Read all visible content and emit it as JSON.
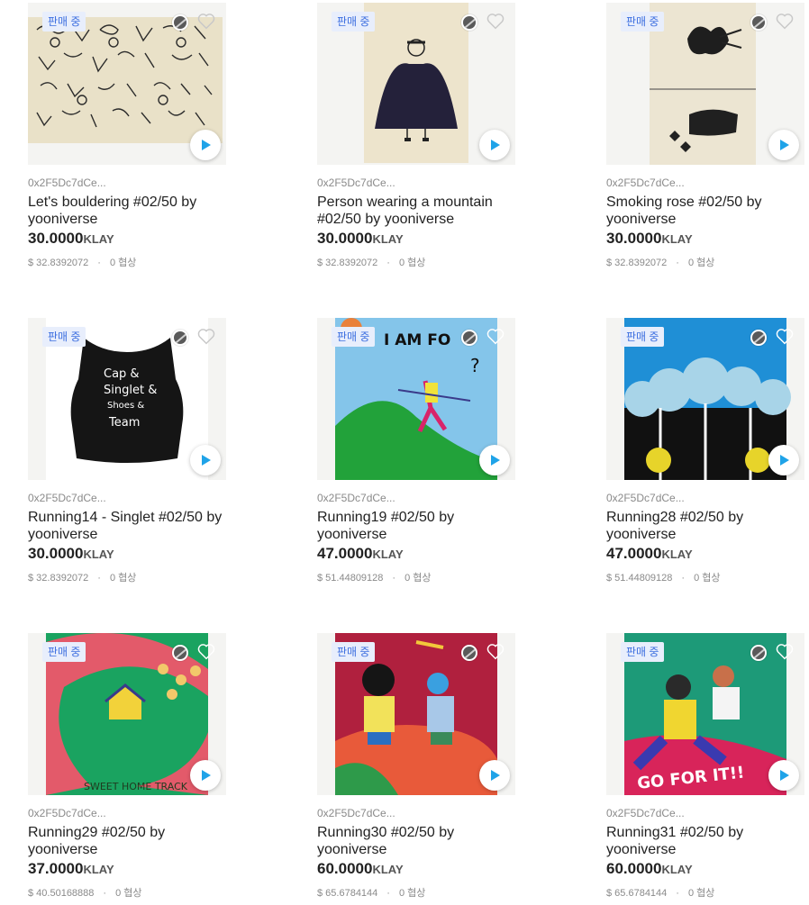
{
  "items": [
    {
      "badge": "판매 중",
      "owner": "0x2F5Dc7dCe...",
      "title": "Let's bouldering #02/50 by yooniverse",
      "price": "30.0000",
      "unit": "KLAY",
      "usd": "$ 32.8392072",
      "offers": "0 협상"
    },
    {
      "badge": "판매 중",
      "owner": "0x2F5Dc7dCe...",
      "title": "Person wearing a mountain #02/50 by yooniverse",
      "price": "30.0000",
      "unit": "KLAY",
      "usd": "$ 32.8392072",
      "offers": "0 협상"
    },
    {
      "badge": "판매 중",
      "owner": "0x2F5Dc7dCe...",
      "title": "Smoking rose #02/50 by yooniverse",
      "price": "30.0000",
      "unit": "KLAY",
      "usd": "$ 32.8392072",
      "offers": "0 협상"
    },
    {
      "badge": "판매 중",
      "owner": "0x2F5Dc7dCe...",
      "title": "Running14 - Singlet #02/50 by yooniverse",
      "price": "30.0000",
      "unit": "KLAY",
      "usd": "$ 32.8392072",
      "offers": "0 협상",
      "art_text": [
        "Cap &",
        "Singlet &",
        "Shoes &",
        "Team"
      ]
    },
    {
      "badge": "판매 중",
      "owner": "0x2F5Dc7dCe...",
      "title": "Running19 #02/50 by yooniverse",
      "price": "47.0000",
      "unit": "KLAY",
      "usd": "$ 51.44809128",
      "offers": "0 협상",
      "art_text": [
        "I AM FO",
        "?"
      ]
    },
    {
      "badge": "판매 중",
      "owner": "0x2F5Dc7dCe...",
      "title": "Running28 #02/50 by yooniverse",
      "price": "47.0000",
      "unit": "KLAY",
      "usd": "$ 51.44809128",
      "offers": "0 협상"
    },
    {
      "badge": "판매 중",
      "owner": "0x2F5Dc7dCe...",
      "title": "Running29 #02/50 by yooniverse",
      "price": "37.0000",
      "unit": "KLAY",
      "usd": "$ 40.50168888",
      "offers": "0 협상",
      "art_text": [
        "SWEET HOME TRACK"
      ]
    },
    {
      "badge": "판매 중",
      "owner": "0x2F5Dc7dCe...",
      "title": "Running30 #02/50 by yooniverse",
      "price": "60.0000",
      "unit": "KLAY",
      "usd": "$ 65.6784144",
      "offers": "0 협상"
    },
    {
      "badge": "판매 중",
      "owner": "0x2F5Dc7dCe...",
      "title": "Running31 #02/50 by yooniverse",
      "price": "60.0000",
      "unit": "KLAY",
      "usd": "$ 65.6784144",
      "offers": "0 협상",
      "art_text": [
        "GO FOR IT!!"
      ]
    }
  ],
  "colors": {
    "accent": "#1fa3e8",
    "badge_text": "#3d6fe0",
    "badge_bg": "#e8eefc"
  },
  "icons": {
    "network": "coin-icon",
    "favorite": "heart-icon",
    "play": "play-icon"
  }
}
